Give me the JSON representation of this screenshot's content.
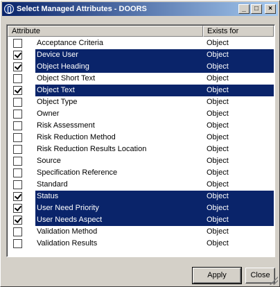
{
  "window": {
    "title": "Select Managed Attributes - DOORS",
    "minimize_glyph": "_",
    "maximize_glyph": "□",
    "close_glyph": "×"
  },
  "list": {
    "columns": {
      "attribute": "Attribute",
      "exists_for": "Exists for"
    },
    "rows": [
      {
        "name": "Acceptance Criteria",
        "exists_for": "Object",
        "checked": false,
        "selected": false
      },
      {
        "name": "Device User",
        "exists_for": "Object",
        "checked": true,
        "selected": true
      },
      {
        "name": "Object Heading",
        "exists_for": "Object",
        "checked": true,
        "selected": true
      },
      {
        "name": "Object Short Text",
        "exists_for": "Object",
        "checked": false,
        "selected": false
      },
      {
        "name": "Object Text",
        "exists_for": "Object",
        "checked": true,
        "selected": true
      },
      {
        "name": "Object Type",
        "exists_for": "Object",
        "checked": false,
        "selected": false
      },
      {
        "name": "Owner",
        "exists_for": "Object",
        "checked": false,
        "selected": false
      },
      {
        "name": "Risk Assessment",
        "exists_for": "Object",
        "checked": false,
        "selected": false
      },
      {
        "name": "Risk Reduction Method",
        "exists_for": "Object",
        "checked": false,
        "selected": false
      },
      {
        "name": "Risk Reduction Results Location",
        "exists_for": "Object",
        "checked": false,
        "selected": false
      },
      {
        "name": "Source",
        "exists_for": "Object",
        "checked": false,
        "selected": false
      },
      {
        "name": "Specification Reference",
        "exists_for": "Object",
        "checked": false,
        "selected": false
      },
      {
        "name": "Standard",
        "exists_for": "Object",
        "checked": false,
        "selected": false
      },
      {
        "name": "Status",
        "exists_for": "Object",
        "checked": true,
        "selected": true
      },
      {
        "name": "User Need Priority",
        "exists_for": "Object",
        "checked": true,
        "selected": true
      },
      {
        "name": "User Needs Aspect",
        "exists_for": "Object",
        "checked": true,
        "selected": true
      },
      {
        "name": "Validation Method",
        "exists_for": "Object",
        "checked": false,
        "selected": false
      },
      {
        "name": "Validation Results",
        "exists_for": "Object",
        "checked": false,
        "selected": false
      }
    ]
  },
  "buttons": {
    "apply": "Apply",
    "close": "Close"
  }
}
